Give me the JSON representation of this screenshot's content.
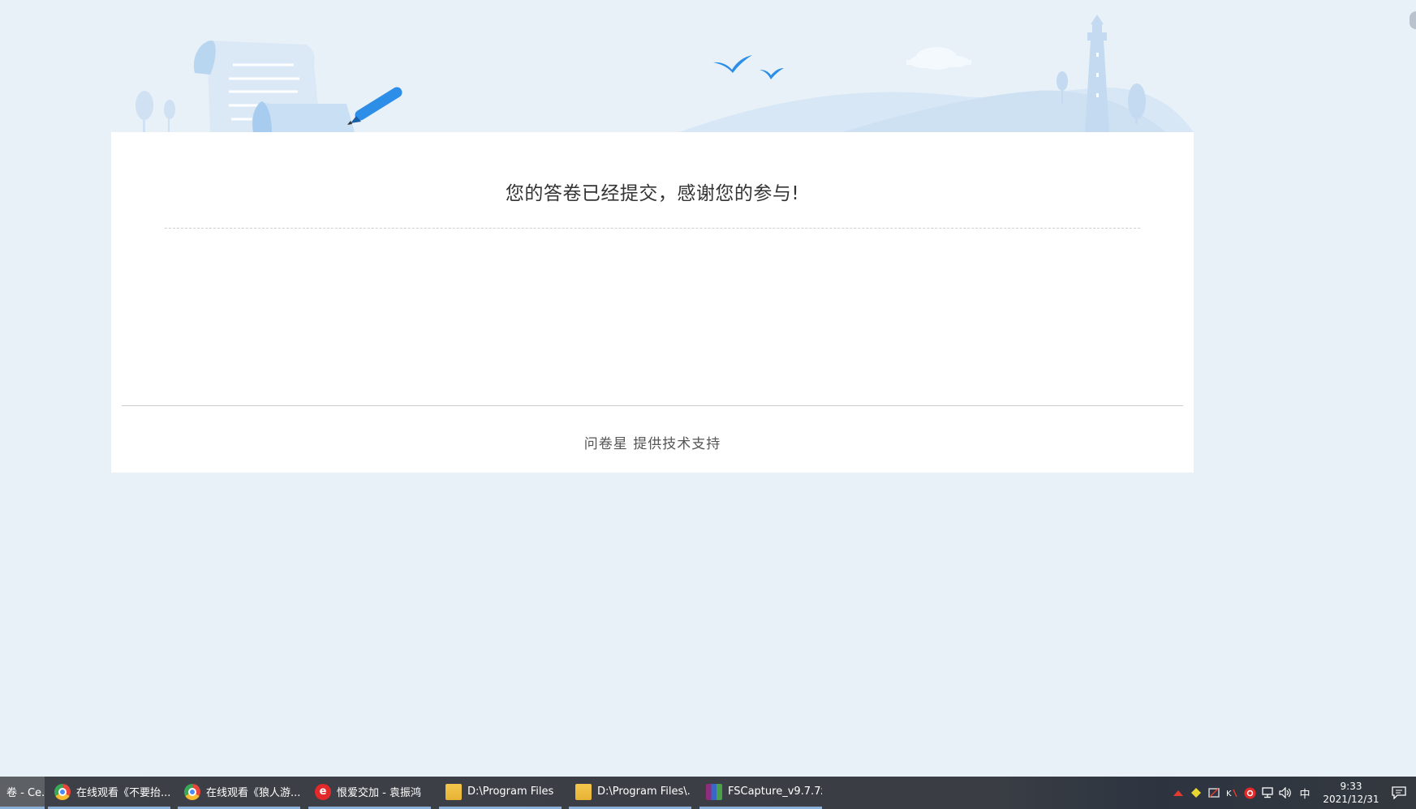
{
  "card": {
    "title": "您的答卷已经提交，感谢您的参与!",
    "footer_brand": "问卷星",
    "footer_text": "提供技术支持"
  },
  "colors": {
    "page_background": "#e8f0f8",
    "card_background": "#ffffff",
    "accent_blue": "#2d8ee8",
    "illustration_light": "#cfe3f5",
    "taskbar": "#3d4147"
  },
  "taskbar": {
    "items": [
      {
        "label": "卷 - Ce...",
        "icon": "partial-window-icon",
        "active": true
      },
      {
        "label": "在线观看《不要抬...",
        "icon": "chrome-icon"
      },
      {
        "label": "在线观看《狼人游...",
        "icon": "chrome-icon"
      },
      {
        "label": "恨爱交加 - 袁振鸿",
        "icon": "netease-music-icon"
      },
      {
        "label": "D:\\Program Files",
        "icon": "folder-icon"
      },
      {
        "label": "D:\\Program Files\\...",
        "icon": "folder-icon"
      },
      {
        "label": "FSCapture_v9.7.7z",
        "icon": "winrar-archive-icon"
      }
    ],
    "tray": {
      "ime": "中",
      "time": "9:33",
      "date": "2021/12/31"
    }
  }
}
